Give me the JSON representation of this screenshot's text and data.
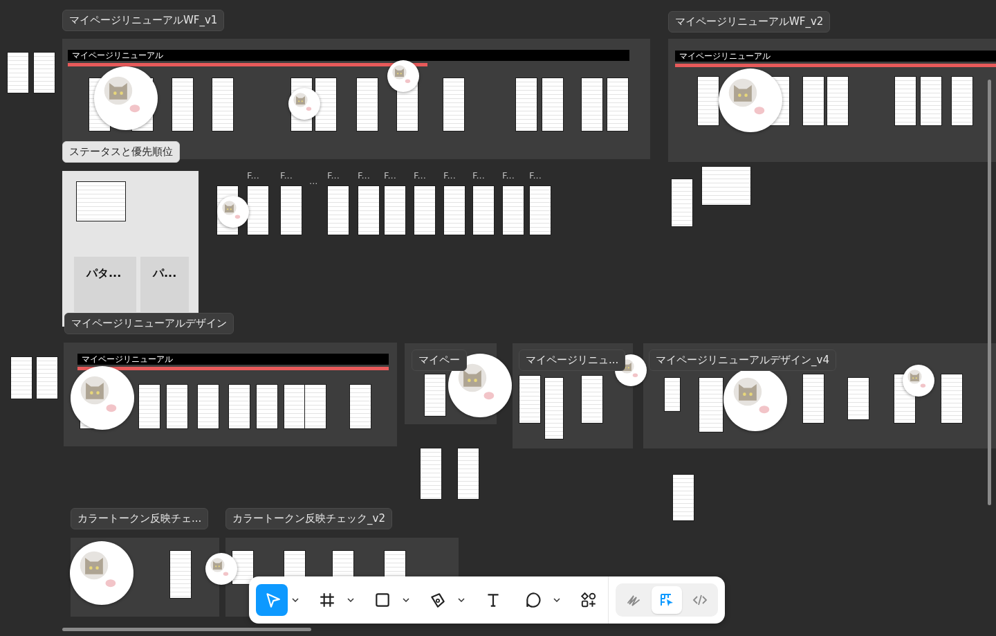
{
  "sections": [
    {
      "title": "マイページリニューアルWF_v1",
      "header": "マイページリニューアル"
    },
    {
      "title": "マイページリニューアルWF_v2",
      "header": "マイページリニューアル"
    },
    {
      "title": "ステータスと優先順位"
    },
    {
      "title": "マイページリニューアルデザイン",
      "header": "マイページリニューアル"
    },
    {
      "title": "マイペー"
    },
    {
      "title": "マイページリニュ..."
    },
    {
      "title": "マイページリニューアルデザイン_v4"
    },
    {
      "title": "カラートークン反映チェ..."
    },
    {
      "title": "カラートークン反映チェック_v2"
    }
  ],
  "status_subframes": [
    {
      "title": "パタ..."
    },
    {
      "title": "パ..."
    }
  ],
  "frame_labels": [
    "F...",
    "F...",
    "...",
    "F...",
    "F...",
    "F...",
    "F...",
    "F...",
    "F...",
    "F...",
    "F..."
  ],
  "toolbar": {
    "tools": [
      {
        "kind": "move",
        "selected": true,
        "menu": true
      },
      {
        "kind": "frame",
        "selected": false,
        "menu": true
      },
      {
        "kind": "shape",
        "selected": false,
        "menu": true
      },
      {
        "kind": "pen",
        "selected": false,
        "menu": true
      },
      {
        "kind": "text",
        "selected": false,
        "menu": false
      },
      {
        "kind": "comment",
        "selected": false,
        "menu": true
      },
      {
        "kind": "actions",
        "selected": false,
        "menu": false
      }
    ],
    "modes": [
      {
        "kind": "draw",
        "selected": false
      },
      {
        "kind": "design",
        "selected": true
      },
      {
        "kind": "dev",
        "selected": false
      }
    ]
  }
}
